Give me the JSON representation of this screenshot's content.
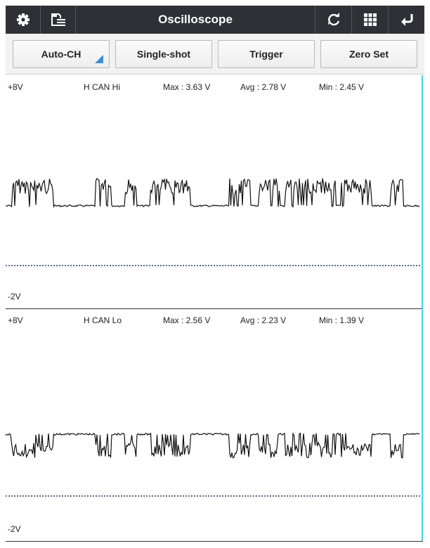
{
  "header": {
    "title": "Oscilloscope"
  },
  "icons": {
    "settings": "gear-icon",
    "save": "save-list-icon",
    "refresh": "refresh-icon",
    "grid": "grid-icon",
    "back": "back-arrow-icon"
  },
  "buttons": {
    "auto_ch": "Auto-CH",
    "single_shot": "Single-shot",
    "trigger": "Trigger",
    "zero_set": "Zero Set"
  },
  "channels": [
    {
      "top_scale": "+8V",
      "bottom_scale": "-2V",
      "name": "H CAN Hi",
      "max": "Max : 3.63 V",
      "avg": "Avg : 2.78 V",
      "min": "Min : 2.45 V"
    },
    {
      "top_scale": "+8V",
      "bottom_scale": "-2V",
      "name": "H CAN Lo",
      "max": "Max : 2.56 V",
      "avg": "Avg : 2.23 V",
      "min": "Min : 1.39 V"
    }
  ],
  "colors": {
    "topbar": "#2f3035",
    "accent": "#3a8fd6",
    "cursor": "#43d3ee",
    "trace": "#111111",
    "zero_line": "#1f3b5a"
  }
}
